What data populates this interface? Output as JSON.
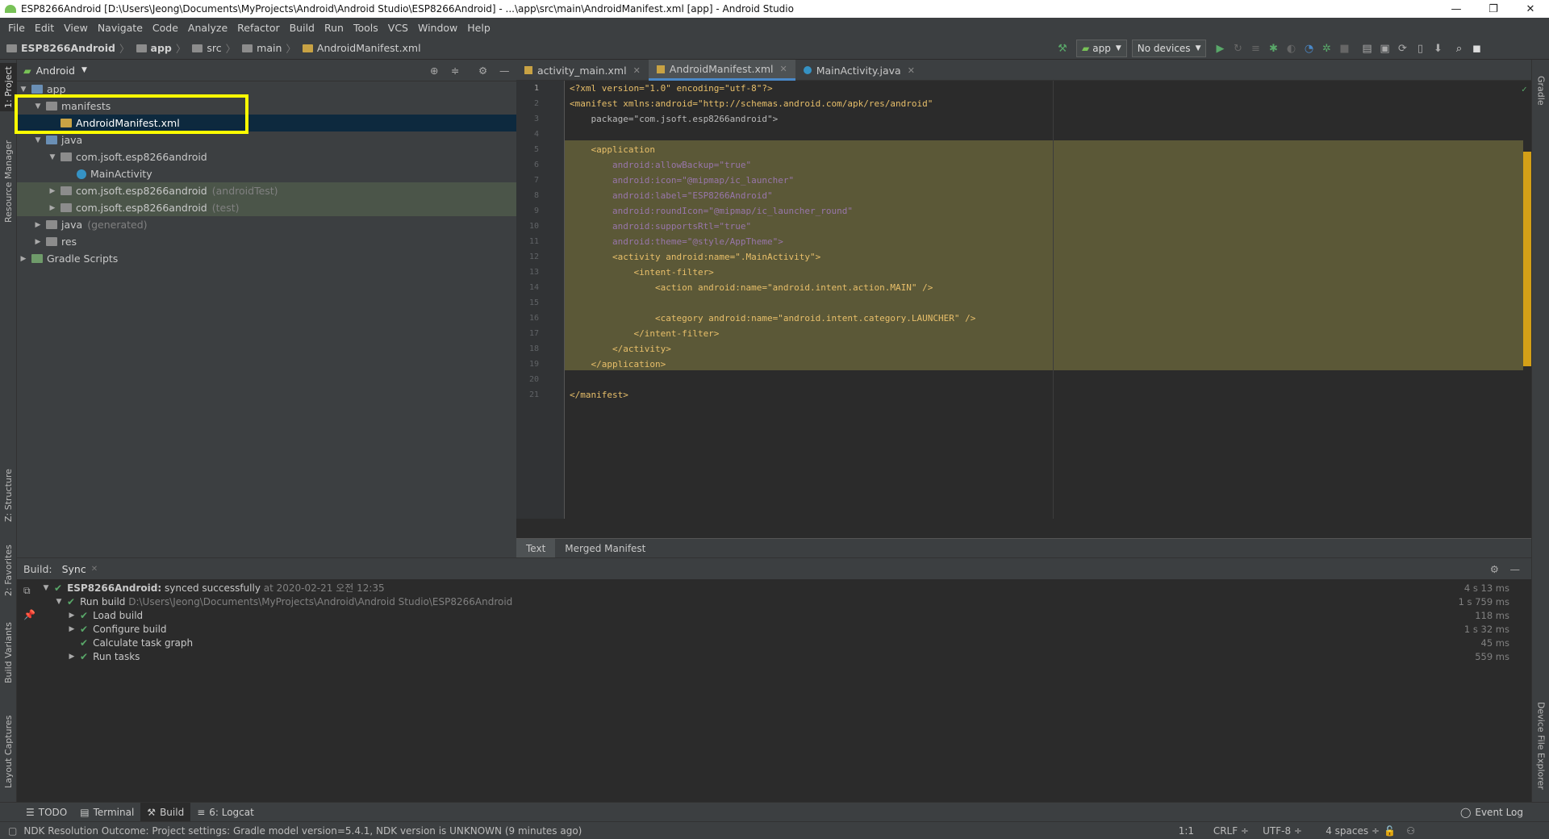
{
  "window": {
    "title": "ESP8266Android [D:\\Users\\Jeong\\Documents\\MyProjects\\Android\\Android Studio\\ESP8266Android] - ...\\app\\src\\main\\AndroidManifest.xml [app] - Android Studio",
    "controls": {
      "minimize": "—",
      "restore": "❐",
      "close": "✕"
    }
  },
  "menu": [
    "File",
    "Edit",
    "View",
    "Navigate",
    "Code",
    "Analyze",
    "Refactor",
    "Build",
    "Run",
    "Tools",
    "VCS",
    "Window",
    "Help"
  ],
  "breadcrumb": [
    "ESP8266Android",
    "app",
    "src",
    "main",
    "AndroidManifest.xml"
  ],
  "toolbar": {
    "run_config": "app",
    "device": "No devices"
  },
  "left_strip": {
    "project": "1: Project",
    "resource_manager": "Resource Manager",
    "structure": "Z: Structure",
    "favorites": "2: Favorites",
    "build_variants": "Build Variants",
    "layout_captures": "Layout Captures"
  },
  "right_strip": {
    "gradle": "Gradle",
    "device_file_explorer": "Device File Explorer"
  },
  "project_panel": {
    "view_mode": "Android",
    "tree": [
      {
        "label": "app",
        "suffix": ""
      },
      {
        "label": "manifests",
        "suffix": ""
      },
      {
        "label": "AndroidManifest.xml",
        "suffix": ""
      },
      {
        "label": "java",
        "suffix": ""
      },
      {
        "label": "com.jsoft.esp8266android",
        "suffix": ""
      },
      {
        "label": "MainActivity",
        "suffix": ""
      },
      {
        "label": "com.jsoft.esp8266android",
        "suffix": "(androidTest)"
      },
      {
        "label": "com.jsoft.esp8266android",
        "suffix": "(test)"
      },
      {
        "label": "java",
        "suffix": "(generated)"
      },
      {
        "label": "res",
        "suffix": ""
      },
      {
        "label": "Gradle Scripts",
        "suffix": ""
      }
    ]
  },
  "editor": {
    "tabs": [
      {
        "label": "activity_main.xml",
        "close": "✕"
      },
      {
        "label": "AndroidManifest.xml",
        "close": "✕"
      },
      {
        "label": "MainActivity.java",
        "close": "✕"
      }
    ],
    "line_numbers": [
      "1",
      "2",
      "3",
      "4",
      "5",
      "6",
      "7",
      "8",
      "9",
      "10",
      "11",
      "12",
      "13",
      "14",
      "15",
      "16",
      "17",
      "18",
      "19",
      "20",
      "21"
    ],
    "code": [
      "<?xml version=\"1.0\" encoding=\"utf-8\"?>",
      "<manifest xmlns:android=\"http://schemas.android.com/apk/res/android\"",
      "    package=\"com.jsoft.esp8266android\">",
      "",
      "    <application",
      "        android:allowBackup=\"true\"",
      "        android:icon=\"@mipmap/ic_launcher\"",
      "        android:label=\"ESP8266Android\"",
      "        android:roundIcon=\"@mipmap/ic_launcher_round\"",
      "        android:supportsRtl=\"true\"",
      "        android:theme=\"@style/AppTheme\">",
      "        <activity android:name=\".MainActivity\">",
      "            <intent-filter>",
      "                <action android:name=\"android.intent.action.MAIN\" />",
      "",
      "                <category android:name=\"android.intent.category.LAUNCHER\" />",
      "            </intent-filter>",
      "        </activity>",
      "    </application>",
      "",
      "</manifest>"
    ],
    "bottom_tabs": [
      "Text",
      "Merged Manifest"
    ]
  },
  "build_panel": {
    "header": "Build:",
    "tab": "Sync",
    "rows": [
      {
        "title": "ESP8266Android:",
        "text": "synced successfully",
        "detail": "at 2020-02-21 오전 12:35",
        "duration": "4 s 13 ms"
      },
      {
        "title": "Run build",
        "text": "",
        "detail": "D:\\Users\\Jeong\\Documents\\MyProjects\\Android\\Android Studio\\ESP8266Android",
        "duration": "1 s 759 ms"
      },
      {
        "title": "Load build",
        "text": "",
        "detail": "",
        "duration": "118 ms"
      },
      {
        "title": "Configure build",
        "text": "",
        "detail": "",
        "duration": "1 s 32 ms"
      },
      {
        "title": "Calculate task graph",
        "text": "",
        "detail": "",
        "duration": "45 ms"
      },
      {
        "title": "Run tasks",
        "text": "",
        "detail": "",
        "duration": "559 ms"
      }
    ]
  },
  "bottom_tools": {
    "todo": "TODO",
    "terminal": "Terminal",
    "build": "Build",
    "logcat": "6: Logcat",
    "event_log": "Event Log"
  },
  "status": {
    "message": "NDK Resolution Outcome: Project settings: Gradle model version=5.4.1, NDK version is UNKNOWN (9 minutes ago)",
    "position": "1:1",
    "line_sep": "CRLF ÷",
    "encoding": "UTF-8 ÷",
    "indent": "4 spaces ÷"
  },
  "colors": {
    "accent": "#4a88c7",
    "highlight_box": "#ffff00",
    "success": "#59a869",
    "selection": "#0d293e"
  }
}
